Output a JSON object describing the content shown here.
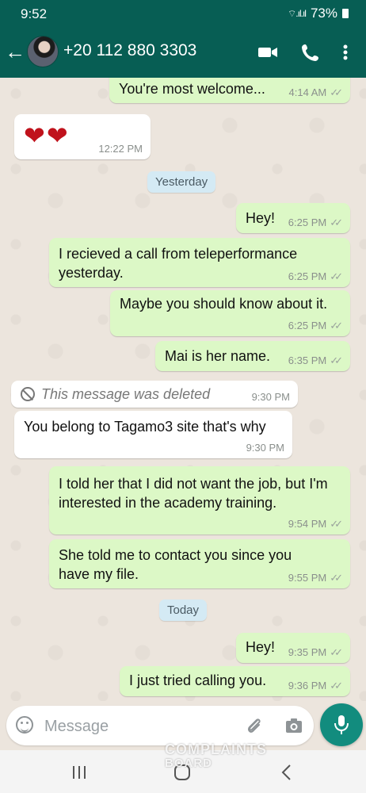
{
  "status_bar": {
    "time": "9:52",
    "signal": "⌔.ıl.ıl",
    "battery": "73%"
  },
  "header": {
    "contact_name": "+20 112 880 3303"
  },
  "messages": [
    {
      "side": "out",
      "text": "You're most welcome...",
      "time": "4:14 AM"
    },
    {
      "side": "in",
      "text": "❤❤",
      "time": "12:22 PM"
    },
    {
      "type": "day",
      "label": "Yesterday"
    },
    {
      "side": "out",
      "text": "Hey!",
      "time": "6:25 PM"
    },
    {
      "side": "out",
      "text": "I recieved a call from teleperformance yesterday.",
      "time": "6:25 PM"
    },
    {
      "side": "out",
      "text": "Maybe you should know about it.",
      "time": "6:25 PM"
    },
    {
      "side": "out",
      "text": "Mai is her name.",
      "time": "6:35 PM"
    },
    {
      "side": "in",
      "text": "This message was deleted",
      "time": "9:30 PM",
      "deleted": true
    },
    {
      "side": "in",
      "text": "You belong to Tagamo3 site that's why",
      "time": "9:30 PM"
    },
    {
      "side": "out",
      "text": "I told her that I did not want the job, but I'm interested in the academy training.",
      "time": "9:54 PM"
    },
    {
      "side": "out",
      "text": "She told me to contact you since you have my file.",
      "time": "9:55 PM"
    },
    {
      "type": "day",
      "label": "Today"
    },
    {
      "side": "out",
      "text": "Hey!",
      "time": "9:35 PM"
    },
    {
      "side": "out",
      "text": "I just tried calling you.",
      "time": "9:36 PM"
    }
  ],
  "composer": {
    "placeholder": "Message"
  },
  "watermark": {
    "line1": "COMPLAINTS",
    "line2": "BOARD"
  },
  "colors": {
    "header": "#075e54",
    "outgoing": "#dcf8c6",
    "incoming": "#ffffff",
    "fab": "#128c7e"
  },
  "icons": [
    "back-arrow-icon",
    "video-icon",
    "phone-icon",
    "more-icon",
    "emoji-icon",
    "attach-icon",
    "camera-icon",
    "mic-icon",
    "recents-icon",
    "home-icon",
    "nav-back-icon"
  ]
}
